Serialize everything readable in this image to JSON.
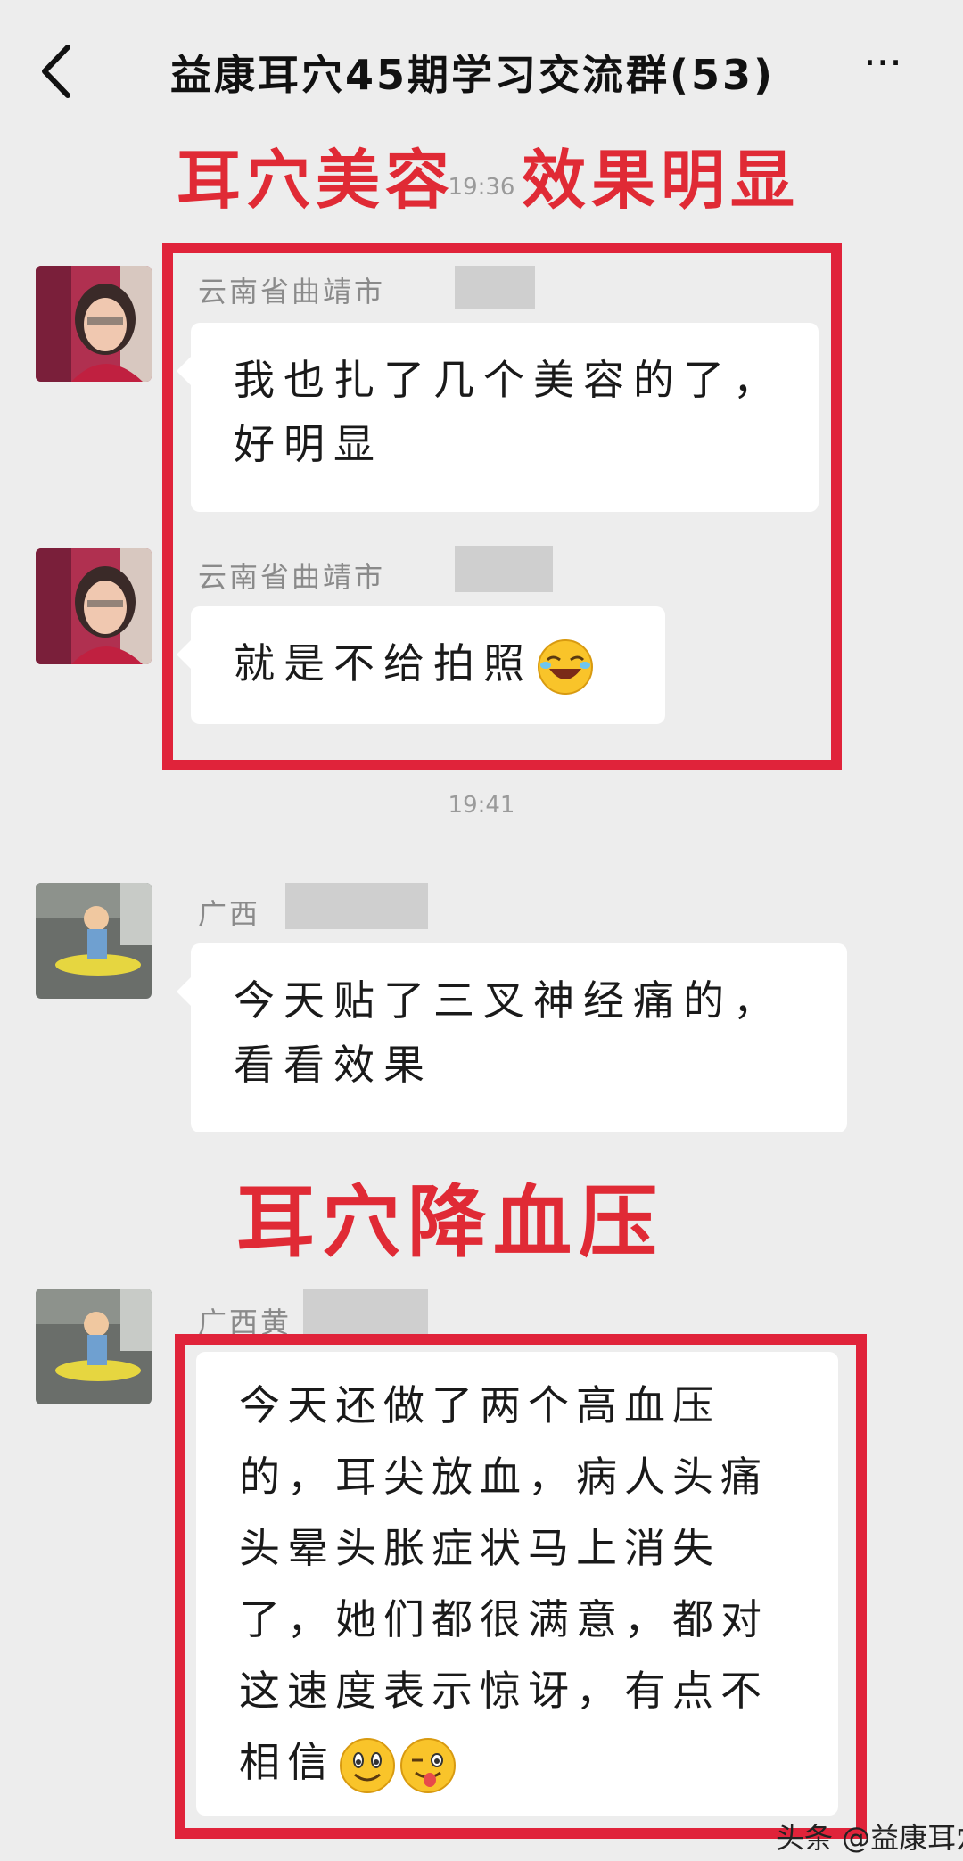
{
  "header": {
    "title": "益康耳穴45期学习交流群(53)",
    "more_label": "···"
  },
  "overlays": {
    "title1_part1": "耳穴美容",
    "title1_part2": "效果明显",
    "title2": "耳穴降血压"
  },
  "timestamps": [
    "19:36",
    "19:41"
  ],
  "messages": [
    {
      "sender": "云南省曲靖市",
      "text": "我也扎了几个美容的了，好明显"
    },
    {
      "sender": "云南省曲靖市",
      "text": "就是不给拍照"
    },
    {
      "sender": "广西",
      "text": "今天贴了三叉神经痛的，看看效果"
    },
    {
      "sender": "广西黄",
      "text": "今天还做了两个高血压的，耳尖放血，病人头痛头晕头胀症状马上消失了，她们都很满意，都对这速度表示惊讶，有点不相信"
    }
  ],
  "watermark": "头条 @益康耳穴",
  "icons": [
    "back-arrow-icon",
    "more-icon",
    "laughing-emoji-icon",
    "smile-emoji-icon",
    "wink-tongue-emoji-icon"
  ]
}
